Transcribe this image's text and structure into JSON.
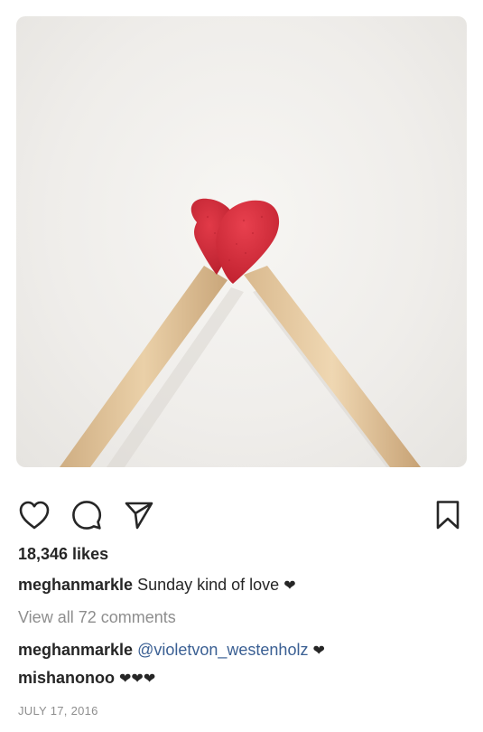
{
  "post": {
    "photo_alt": "",
    "likes_text": "18,346 likes",
    "caption": {
      "username": "meghanmarkle",
      "text": "Sunday kind of love",
      "emoji": "❤"
    },
    "view_comments_text": "View all 72 comments",
    "comments": [
      {
        "username": "meghanmarkle",
        "mention": "@violetvon_westenholz",
        "emoji": "❤"
      },
      {
        "username": "mishanonoo",
        "emoji": "❤❤❤"
      }
    ],
    "date": "JULY 17, 2016"
  },
  "icons": {
    "like": "heart-outline-icon",
    "comment": "comment-bubble-icon",
    "share": "paper-plane-icon",
    "save": "bookmark-icon"
  },
  "colors": {
    "text": "#262626",
    "muted": "#8e8e8e",
    "mention": "#3a5f93",
    "match_head": "#d42a3a",
    "match_stick": "#e2c7a0"
  }
}
